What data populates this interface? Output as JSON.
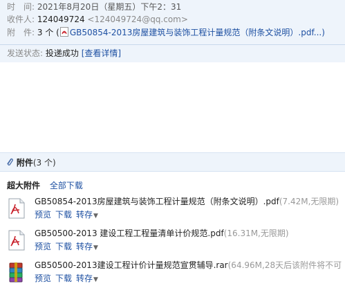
{
  "header": {
    "time_label": "时　间:",
    "time_value": "2021年8月20日（星期五）下午2：31",
    "to_label": "收件人:",
    "to_name": "124049724",
    "to_email": "<124049724@qq.com>",
    "att_label": "附　件:",
    "att_count": "3 个 (",
    "att_first": "GB50854-2013房屋建筑与装饰工程计量规范（附条文说明）.pdf...)",
    "status_label": "发送状态:",
    "status_value": "投递成功",
    "status_link": "[查看详情]"
  },
  "attachments": {
    "title": "附件",
    "count": "(3 个)",
    "super_label": "超大附件",
    "download_all": "全部下载",
    "files": [
      {
        "name": "GB50854-2013房屋建筑与装饰工程计量规范（附条文说明）.pdf",
        "meta": "(7.42M,无限期)",
        "icon": "pdf-icon"
      },
      {
        "name": "GB50500-2013 建设工程工程量清单计价规范.pdf",
        "meta": "(16.31M,无限期)",
        "icon": "pdf-icon"
      },
      {
        "name": "GB50500-2013建设工程计价计量规范宣贯辅导.rar",
        "meta": "(64.96M,28天后该附件将不可",
        "icon": "rar-icon"
      }
    ],
    "actions": {
      "preview": "预览",
      "download": "下载",
      "save": "转存",
      "caret": "▼"
    }
  },
  "colors": {
    "header_bg": "#eef4fb",
    "link": "#1e50a2",
    "pdf_red": "#c8202a"
  }
}
